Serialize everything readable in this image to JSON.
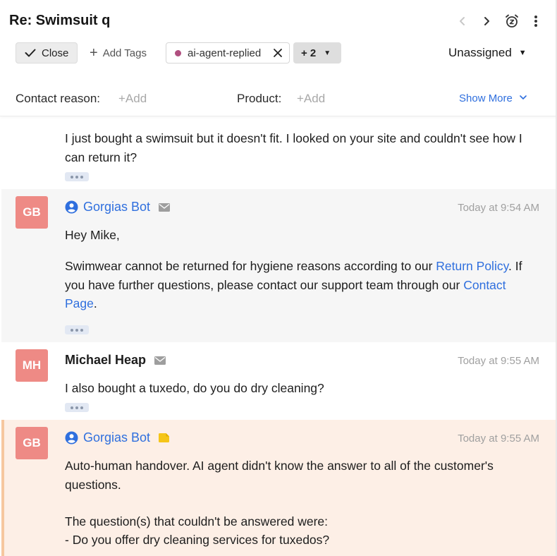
{
  "ticket": {
    "title": "Re: Swimsuit q",
    "prev_label": "‹",
    "next_label": "›"
  },
  "toolbar": {
    "close_label": "Close",
    "add_tags_label": "Add Tags",
    "tag_label": "ai-agent-replied",
    "tag_color": "#b04f7f",
    "more_tags_label": "+ 2",
    "assignee_label": "Unassigned"
  },
  "fields": {
    "contact_reason_label": "Contact reason:",
    "contact_reason_add": "+Add",
    "product_label": "Product:",
    "product_add": "+Add",
    "show_more_label": "Show More"
  },
  "messages": [
    {
      "text": "I just bought a swimsuit but it doesn't fit. I looked on your site and couldn't see how I can return it?"
    },
    {
      "avatar": "GB",
      "sender": "Gorgias Bot",
      "channel_icon": "email-icon",
      "time": "Today at 9:54 AM",
      "greeting": "Hey Mike,",
      "body_1": "Swimwear cannot be returned for hygiene reasons according to our ",
      "link_1": "Return Policy",
      "body_2": ". If you have further questions, please contact our support team through our ",
      "link_2": "Contact Page",
      "body_3": "."
    },
    {
      "avatar": "MH",
      "sender": "Michael Heap",
      "channel_icon": "email-icon",
      "time": "Today at 9:55 AM",
      "text": "I also bought a tuxedo, do you do dry cleaning?"
    },
    {
      "avatar": "GB",
      "sender": "Gorgias Bot",
      "channel_icon": "internal-note-icon",
      "time": "Today at 9:55 AM",
      "line_1": "Auto-human handover. AI agent didn't know the answer to all of the customer's questions.",
      "line_2": "The question(s) that couldn't be answered were:",
      "line_3": "- Do you offer dry cleaning services for tuxedos?"
    }
  ],
  "colors": {
    "accent": "#2f6fde",
    "avatar": "#ee8a85",
    "note_bg": "#fdefe6",
    "note_border": "#f6c79f",
    "bot_bg": "#f6f6f6",
    "note_icon": "#f5c518"
  }
}
